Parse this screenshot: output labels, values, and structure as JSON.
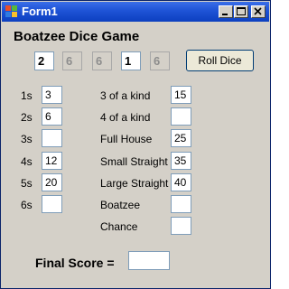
{
  "window": {
    "title": "Form1",
    "icon": "app-window-icon",
    "controls": [
      "minimize-icon",
      "maximize-icon",
      "close-icon"
    ]
  },
  "game": {
    "title": "Boatzee Dice Game",
    "dice": [
      {
        "value": "2",
        "enabled": true
      },
      {
        "value": "6",
        "enabled": false
      },
      {
        "value": "6",
        "enabled": false
      },
      {
        "value": "1",
        "enabled": true
      },
      {
        "value": "6",
        "enabled": false
      }
    ],
    "roll_button": "Roll Dice"
  },
  "upper_section": [
    {
      "label": "1s",
      "value": "3"
    },
    {
      "label": "2s",
      "value": "6"
    },
    {
      "label": "3s",
      "value": ""
    },
    {
      "label": "4s",
      "value": "12"
    },
    {
      "label": "5s",
      "value": "20"
    },
    {
      "label": "6s",
      "value": ""
    }
  ],
  "lower_section": [
    {
      "label": "3 of a kind",
      "value": "15"
    },
    {
      "label": "4 of a kind",
      "value": ""
    },
    {
      "label": "Full House",
      "value": "25"
    },
    {
      "label": "Small Straight",
      "value": "35"
    },
    {
      "label": "Large Straight",
      "value": "40"
    },
    {
      "label": "Boatzee",
      "value": ""
    },
    {
      "label": "Chance",
      "value": ""
    }
  ],
  "final_score": {
    "label": "Final Score =",
    "value": ""
  }
}
